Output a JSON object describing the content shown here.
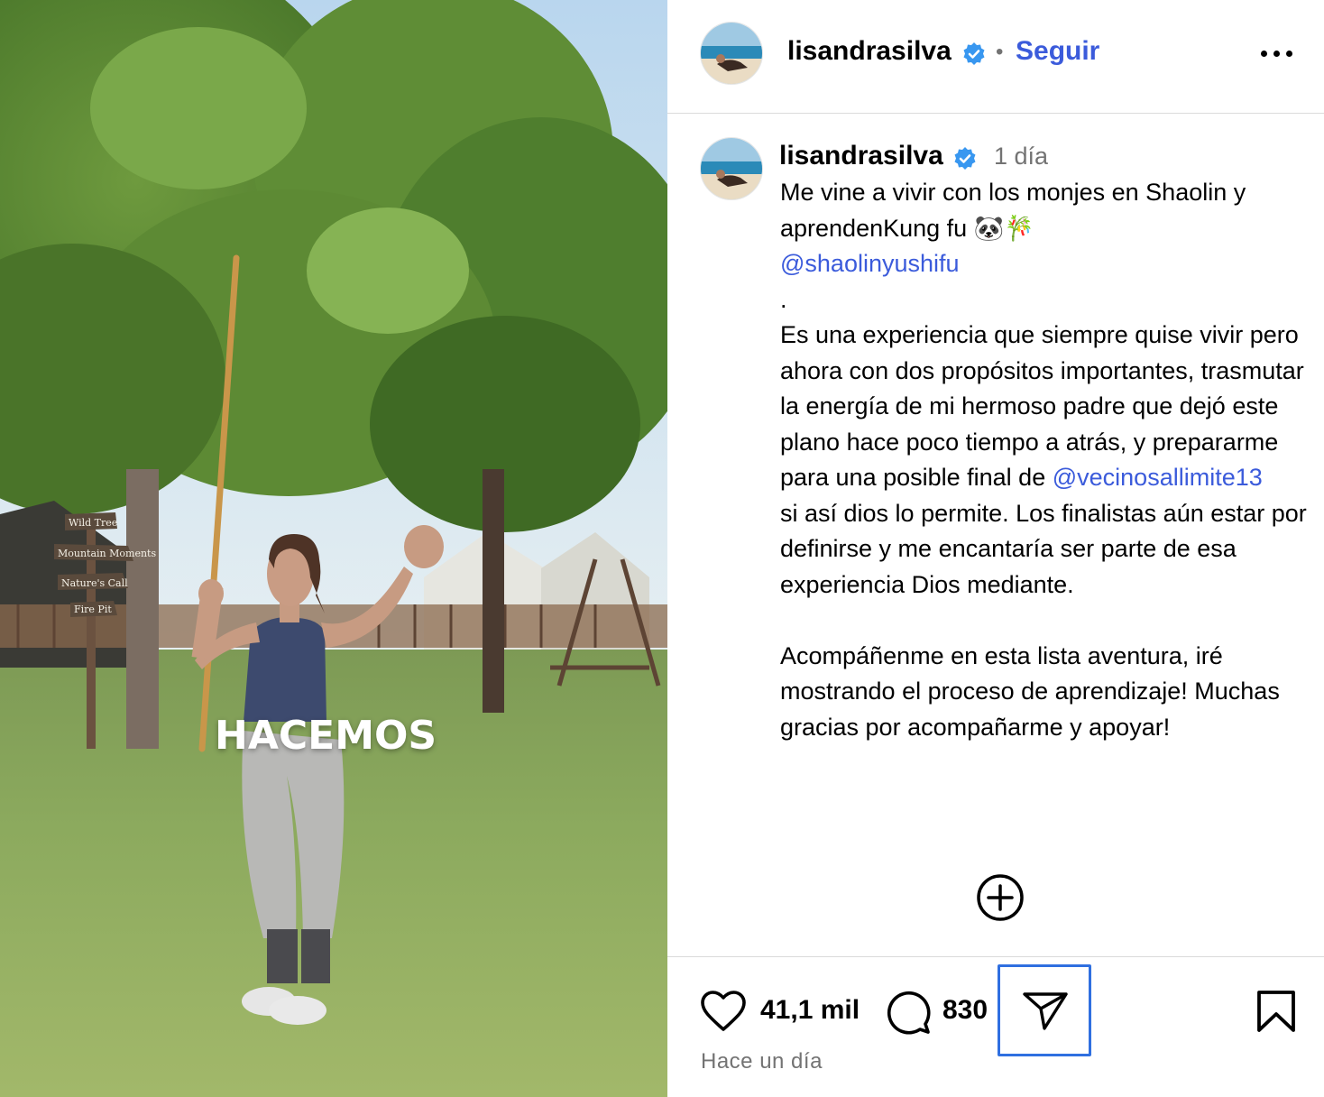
{
  "media": {
    "overlay_text": "HACEMOS",
    "signs": [
      "Wild Tree",
      "Mountain Moments",
      "Nature's Call",
      "Fire Pit"
    ]
  },
  "header": {
    "username": "lisandrasilva",
    "separator": "•",
    "follow_label": "Seguir"
  },
  "caption": {
    "username": "lisandrasilva",
    "time": "1 día",
    "text_1": "Me vine a vivir con los monjes en Shaolin y aprendenKung fu 🐼🎋\n",
    "mention_1": "@shaolinyushifu",
    "text_2": "\n.\nEs una experiencia que siempre quise vivir pero ahora con dos propósitos importantes, trasmutar la energía de mi hermoso padre que dejó este plano hace poco tiempo a atrás, y prepararme para una posible final de ",
    "mention_2": "@vecinosallimite13",
    "text_3": "\nsi así dios lo permite. Los finalistas aún estar por definirse y me encantaría ser parte de esa experiencia Dios mediante.\n\nAcompáñenme en esta lista aventura, iré mostrando el proceso de aprendizaje! Muchas gracias por acompañarme y apoyar!"
  },
  "actions": {
    "likes": "41,1 mil",
    "comments": "830",
    "posted": "Hace un día"
  },
  "icons": [
    "verified-badge-icon",
    "more-options-icon",
    "expand-plus-icon",
    "heart-icon",
    "comment-icon",
    "share-icon",
    "bookmark-icon"
  ],
  "colors": {
    "link_blue": "#3b5bdb",
    "verified_blue": "#3897f0",
    "share_highlight": "#2f6fe0",
    "muted_text": "#737373",
    "divider": "#dbdbdb"
  }
}
